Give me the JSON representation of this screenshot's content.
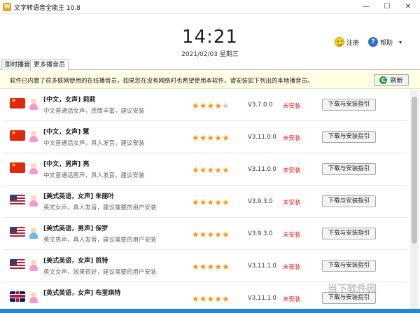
{
  "window": {
    "title": "文字转语音全能王 10.8",
    "app_icon_glyph": "W",
    "minimize": "—",
    "maximize": "☐",
    "close": "✕"
  },
  "header": {
    "time": "14:21",
    "date": "2021/02/03 星期三",
    "register_label": "注册",
    "help_label": "帮助",
    "help_arrow": "▾"
  },
  "tabs": [
    {
      "label": "即时播音"
    },
    {
      "label": "更多播音员"
    }
  ],
  "notice": {
    "text": "软件已内置了很多联网使用的在线播音员，如果您在没有网络时也希望使用本软件，请安装如下列出的本地播音员。",
    "refresh_label": "刷新"
  },
  "voices": [
    {
      "name": "[中文，女声] 莉莉",
      "desc": "中文普通话女声，感情丰富，建议安装",
      "stars": "★★★★☆",
      "rating": 4,
      "version": "V3.7.0.0",
      "status": "未安装",
      "button": "下载与安装指引",
      "flag": "cn",
      "gender": "female"
    },
    {
      "name": "[中文，女声] 慧",
      "desc": "中文普通话女声，真人发音，建议安装",
      "stars": "★★★★★",
      "rating": 5,
      "version": "V3.11.0.0",
      "status": "未安装",
      "button": "下载与安装指引",
      "flag": "cn",
      "gender": "female"
    },
    {
      "name": "[中文，男声] 亮",
      "desc": "中文普通话男声，真人发音，建议安装",
      "stars": "★★★★★",
      "rating": 5,
      "version": "V3.11.0.0",
      "status": "未安装",
      "button": "下载与安装指引",
      "flag": "cn",
      "gender": "female"
    },
    {
      "name": "[美式英语，女声] 朱丽叶",
      "desc": "英文女声，真人发音，建议需要的用户安装",
      "stars": "★★★★★",
      "rating": 5,
      "version": "V3.9.3.0",
      "status": "未安装",
      "button": "下载与安装指引",
      "flag": "us",
      "gender": "female"
    },
    {
      "name": "[美式英语，男声] 保罗",
      "desc": "英文男声，真人发音，建议需要的用户安装",
      "stars": "★★★★★",
      "rating": 5,
      "version": "V3.9.3.0",
      "status": "未安装",
      "button": "下载与安装指引",
      "flag": "us",
      "gender": "male"
    },
    {
      "name": "[美式英语，女声] 凯特",
      "desc": "英文女声，效果很好，建议需要的用户安装",
      "stars": "★★★★★",
      "rating": 5,
      "version": "V3.11.1.0",
      "status": "未安装",
      "button": "下载与安装指引",
      "flag": "us",
      "gender": "female"
    },
    {
      "name": "[英式英语，女声] 布里琪特",
      "desc": "",
      "stars": "★★★★★",
      "rating": 5,
      "version": "V3.11.1.0",
      "status": "未安装",
      "button": "下载与安装指引",
      "flag": "uk",
      "gender": "female"
    }
  ],
  "watermark": "当下软件园",
  "colors": {
    "accent": "#1e88d4",
    "star": "#f09a1a",
    "status": "#e02020",
    "notice_bg": "#ffffe6"
  }
}
